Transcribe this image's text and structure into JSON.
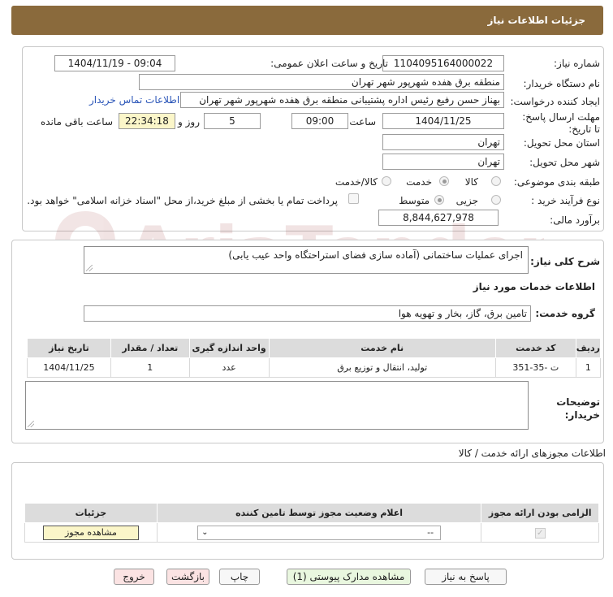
{
  "header": {
    "title": "جزئیات اطلاعات نیاز"
  },
  "need": {
    "number_label": "شماره نیاز:",
    "number": "1104095164000022",
    "announce_label": "تاریخ و ساعت اعلان عمومی:",
    "announce": "1404/11/19 - 09:04",
    "buyer_label": "نام دستگاه خریدار:",
    "buyer": "منطقه برق هفده شهرپور شهر تهران",
    "creator_label": "ایجاد کننده درخواست:",
    "creator": "بهناز حسن رفیع رئیس اداره پشتیبانی منطقه برق هفده شهرپور شهر تهران",
    "contact_link": "اطلاعات تماس خریدار",
    "deadline_label": "مهلت ارسال پاسخ: تا تاریخ:",
    "deadline_date": "1404/11/25",
    "time_label": "ساعت",
    "deadline_time": "09:00",
    "days": "5",
    "days_label": "روز و",
    "remaining": "22:34:18",
    "remaining_label": "ساعت باقی مانده",
    "province_label": "استان محل تحویل:",
    "province": "تهران",
    "city_label": "شهر محل تحویل:",
    "city": "تهران",
    "category_label": "طبقه بندی موضوعی:",
    "category_options": [
      "کالا",
      "خدمت",
      "کالا/خدمت"
    ],
    "category_selected": "خدمت",
    "process_label": "نوع فرآیند خرید :",
    "process_options": [
      "جزیی",
      "متوسط"
    ],
    "process_selected": "متوسط",
    "payment_note": "پرداخت تمام یا بخشی از مبلغ خرید،از محل \"اسناد خزانه اسلامی\" خواهد بود.",
    "estimate_label": "برآورد مالی:",
    "estimate": "8,844,627,978"
  },
  "watermark": {
    "text": "AriaTender.neT"
  },
  "description": {
    "label": "شرح کلی نیاز:",
    "text": "اجرای عملیات ساختمانی (آماده سازی فضای استراحتگاه واحد عیب یابی)"
  },
  "services": {
    "section_title": "اطلاعات خدمات مورد نیاز",
    "group_label": "گروه خدمت:",
    "group": "تامین برق، گاز، بخار و تهویه هوا",
    "columns": [
      "ردیف",
      "کد خدمت",
      "نام خدمت",
      "واحد اندازه گیری",
      "تعداد / مقدار",
      "تاریخ نیاز"
    ],
    "rows": [
      {
        "row": "1",
        "code": "ت -35-351",
        "name": "تولید، انتقال و توزیع برق",
        "unit": "عدد",
        "qty": "1",
        "date": "1404/11/25"
      }
    ]
  },
  "buyer_notes": {
    "label": "توضیحات خریدار:",
    "text": ""
  },
  "permits": {
    "section_title": "اطلاعات مجوزهای ارائه خدمت / کالا",
    "columns": [
      "الزامی بودن ارائه مجوز",
      "اعلام وضعیت مجوز توسط تامین کننده",
      "جزئیات"
    ],
    "select_value": "--",
    "view_button": "مشاهده مجوز"
  },
  "actions": {
    "reply": "پاسخ به نیاز",
    "attachments": "مشاهده مدارک پیوستی (1)",
    "print": "چاپ",
    "back": "بازگشت",
    "exit": "خروج"
  }
}
